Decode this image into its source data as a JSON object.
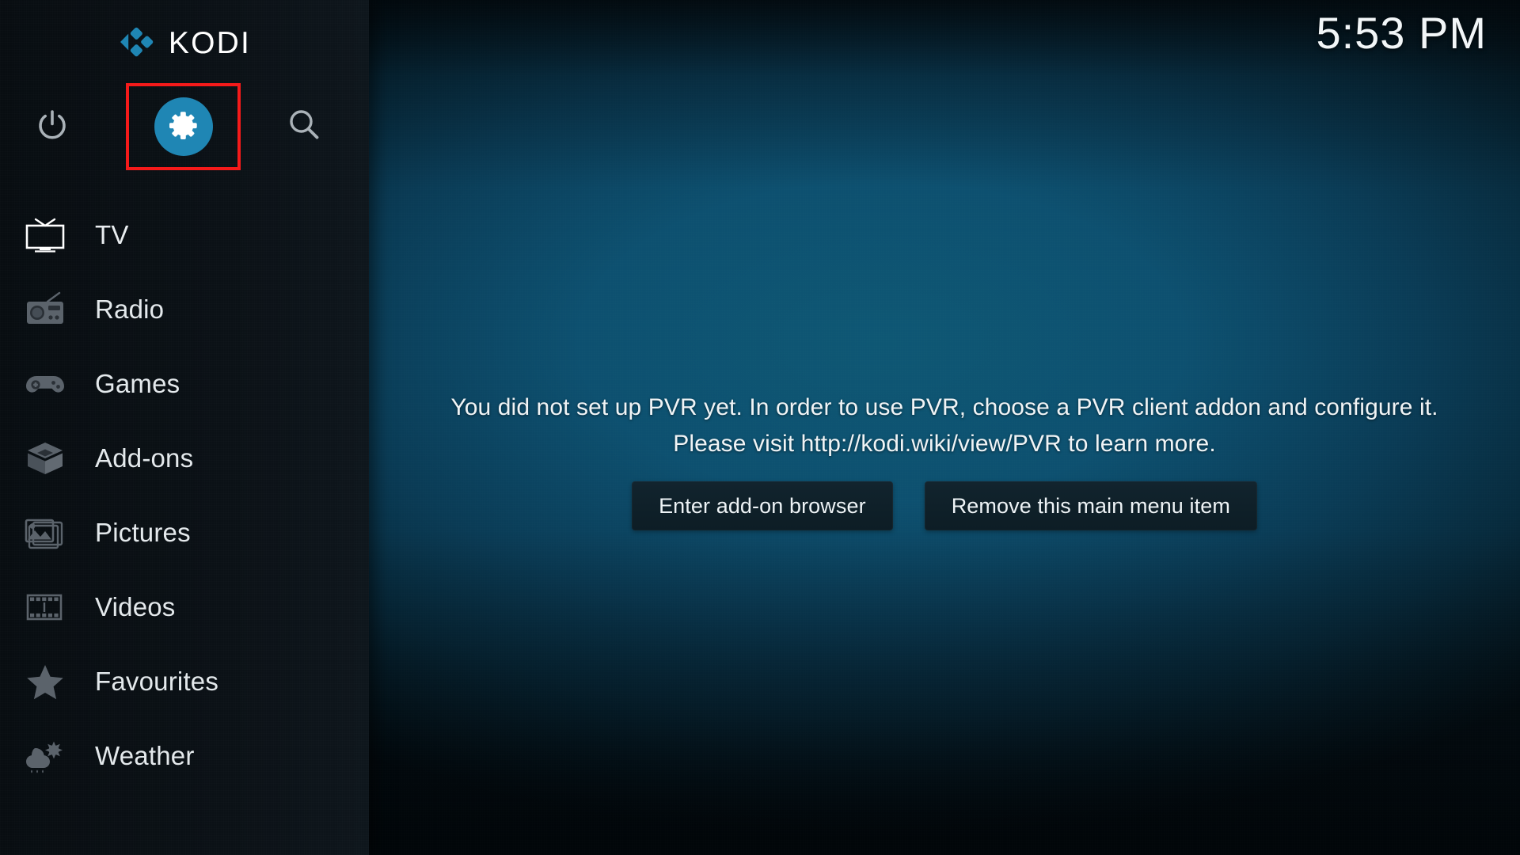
{
  "app": {
    "name": "KODI",
    "logo_icon": "kodi-logo-icon",
    "accent_color": "#1f86b4",
    "highlight_color": "#f51a1a"
  },
  "header": {
    "clock": "5:53 PM"
  },
  "top_actions": [
    {
      "id": "power",
      "icon": "power-icon",
      "label": "Power"
    },
    {
      "id": "settings",
      "icon": "gear-icon",
      "label": "Settings",
      "highlighted": true
    },
    {
      "id": "search",
      "icon": "search-icon",
      "label": "Search"
    }
  ],
  "sidebar": {
    "items": [
      {
        "label": "TV",
        "icon": "tv-icon",
        "selected": true
      },
      {
        "label": "Radio",
        "icon": "radio-icon",
        "selected": false
      },
      {
        "label": "Games",
        "icon": "gamepad-icon",
        "selected": false
      },
      {
        "label": "Add-ons",
        "icon": "package-icon",
        "selected": false
      },
      {
        "label": "Pictures",
        "icon": "pictures-icon",
        "selected": false
      },
      {
        "label": "Videos",
        "icon": "filmstrip-icon",
        "selected": false
      },
      {
        "label": "Favourites",
        "icon": "star-icon",
        "selected": false
      },
      {
        "label": "Weather",
        "icon": "weather-icon",
        "selected": false
      }
    ]
  },
  "main": {
    "message_line1": "You did not set up PVR yet. In order to use PVR, choose a PVR client addon and configure it.",
    "message_line2": "Please visit http://kodi.wiki/view/PVR to learn more.",
    "buttons": [
      {
        "label": "Enter add-on browser"
      },
      {
        "label": "Remove this main menu item"
      }
    ]
  }
}
